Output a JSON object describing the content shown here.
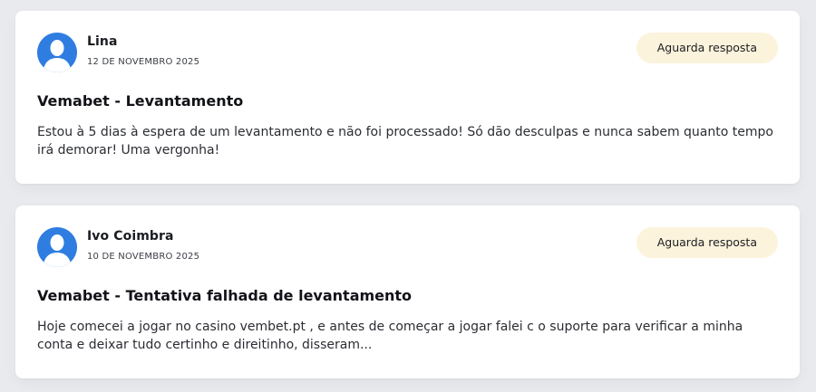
{
  "reviews": [
    {
      "author": "Lina",
      "date": "12 DE NOVEMBRO 2025",
      "status": "Aguarda resposta",
      "title": "Vemabet - Levantamento",
      "text": "Estou à 5 dias à espera de um levantamento e não foi processado! Só dão desculpas e nunca sabem quanto tempo irá demorar! Uma vergonha!",
      "avatar_icon": "user-silhouette-icon"
    },
    {
      "author": "Ivo Coimbra",
      "date": "10 DE NOVEMBRO 2025",
      "status": "Aguarda resposta",
      "title": "Vemabet - Tentativa falhada de levantamento",
      "text": "Hoje comecei a jogar no casino vembet.pt , e antes de começar a jogar falei c o suporte para verificar a minha conta e deixar tudo certinho e direitinho, disseram...",
      "avatar_icon": "user-silhouette-icon"
    }
  ],
  "colors": {
    "page_background": "#e9eaee",
    "card_background": "#ffffff",
    "badge_background": "#fcf3dc",
    "avatar_blue": "#2f7de1"
  }
}
